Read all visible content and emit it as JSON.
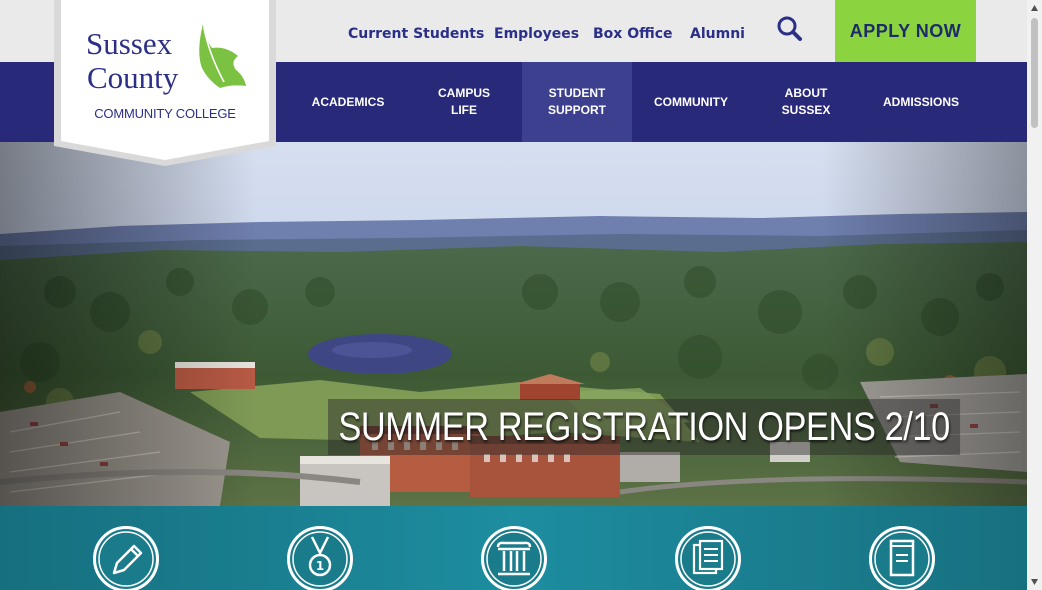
{
  "logo": {
    "line1": "Sussex",
    "line2": "County",
    "line3": "COMMUNITY COLLEGE"
  },
  "utility_nav": [
    {
      "label": "Current Students"
    },
    {
      "label": "Employees"
    },
    {
      "label": "Box Office"
    },
    {
      "label": "Alumni"
    }
  ],
  "search": {
    "icon": "search-icon"
  },
  "apply": {
    "label": "APPLY NOW"
  },
  "main_nav": [
    {
      "line1": "ACADEMICS",
      "line2": ""
    },
    {
      "line1": "CAMPUS",
      "line2": "LIFE"
    },
    {
      "line1": "STUDENT",
      "line2": "SUPPORT"
    },
    {
      "line1": "COMMUNITY",
      "line2": ""
    },
    {
      "line1": "ABOUT",
      "line2": "SUSSEX"
    },
    {
      "line1": "ADMISSIONS",
      "line2": ""
    }
  ],
  "hero": {
    "caption": "SUMMER REGISTRATION OPENS 2/10"
  },
  "quick_links": [
    {
      "icon": "pencil-icon"
    },
    {
      "icon": "medal-icon"
    },
    {
      "icon": "column-icon"
    },
    {
      "icon": "documents-icon"
    },
    {
      "icon": "notebook-icon"
    }
  ],
  "colors": {
    "navy": "#29297a",
    "nav_active": "#3d3f8f",
    "apply_green": "#8cd43f",
    "teal": "#1d8da0",
    "utility_bg": "#eaeaea"
  }
}
